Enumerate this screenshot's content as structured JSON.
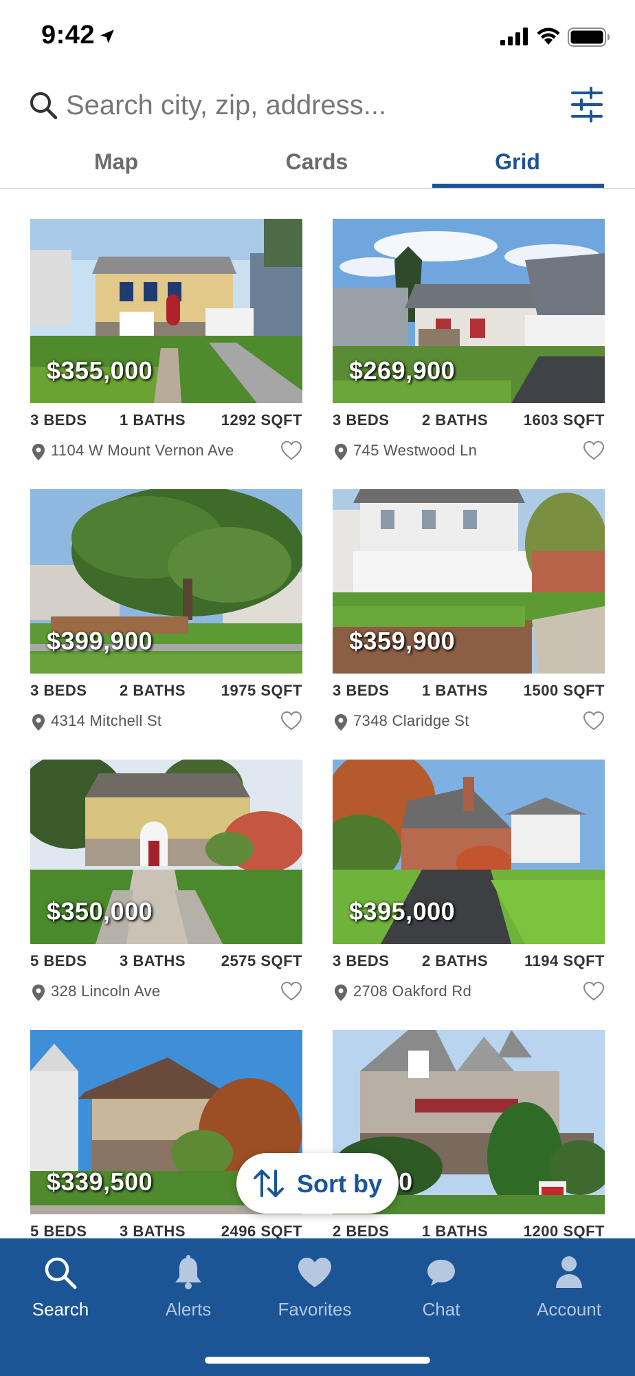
{
  "status_bar": {
    "time": "9:42"
  },
  "search": {
    "placeholder": "Search city, zip, address..."
  },
  "tabs": [
    {
      "label": "Map"
    },
    {
      "label": "Cards"
    },
    {
      "label": "Grid"
    }
  ],
  "active_tab": "Grid",
  "listings": [
    {
      "price": "$355,000",
      "beds": "3 BEDS",
      "baths": "1 BATHS",
      "sqft": "1292 SQFT",
      "address": "1104 W Mount Vernon Ave"
    },
    {
      "price": "$269,900",
      "beds": "3 BEDS",
      "baths": "2 BATHS",
      "sqft": "1603 SQFT",
      "address": "745 Westwood Ln"
    },
    {
      "price": "$399,900",
      "beds": "3 BEDS",
      "baths": "2 BATHS",
      "sqft": "1975 SQFT",
      "address": "4314 Mitchell St"
    },
    {
      "price": "$359,900",
      "beds": "3 BEDS",
      "baths": "1 BATHS",
      "sqft": "1500 SQFT",
      "address": "7348 Claridge St"
    },
    {
      "price": "$350,000",
      "beds": "5 BEDS",
      "baths": "3 BATHS",
      "sqft": "2575 SQFT",
      "address": "328 Lincoln Ave"
    },
    {
      "price": "$395,000",
      "beds": "3 BEDS",
      "baths": "2 BATHS",
      "sqft": "1194 SQFT",
      "address": "2708 Oakford Rd"
    },
    {
      "price": "$339,500",
      "beds": "5 BEDS",
      "baths": "3 BATHS",
      "sqft": "2496 SQFT",
      "address": ""
    },
    {
      "price": "9,900",
      "beds": "2 BEDS",
      "baths": "1 BATHS",
      "sqft": "1200 SQFT",
      "address": ""
    }
  ],
  "sort": {
    "label": "Sort by"
  },
  "bottom_nav": [
    {
      "label": "Search",
      "icon": "search-icon",
      "active": true
    },
    {
      "label": "Alerts",
      "icon": "bell-icon",
      "active": false
    },
    {
      "label": "Favorites",
      "icon": "heart-icon",
      "active": false
    },
    {
      "label": "Chat",
      "icon": "chat-bubble-icon",
      "active": false
    },
    {
      "label": "Account",
      "icon": "person-icon",
      "active": false
    }
  ],
  "colors": {
    "brand": "#1b5596",
    "nav_inactive": "#b6c8e0"
  }
}
